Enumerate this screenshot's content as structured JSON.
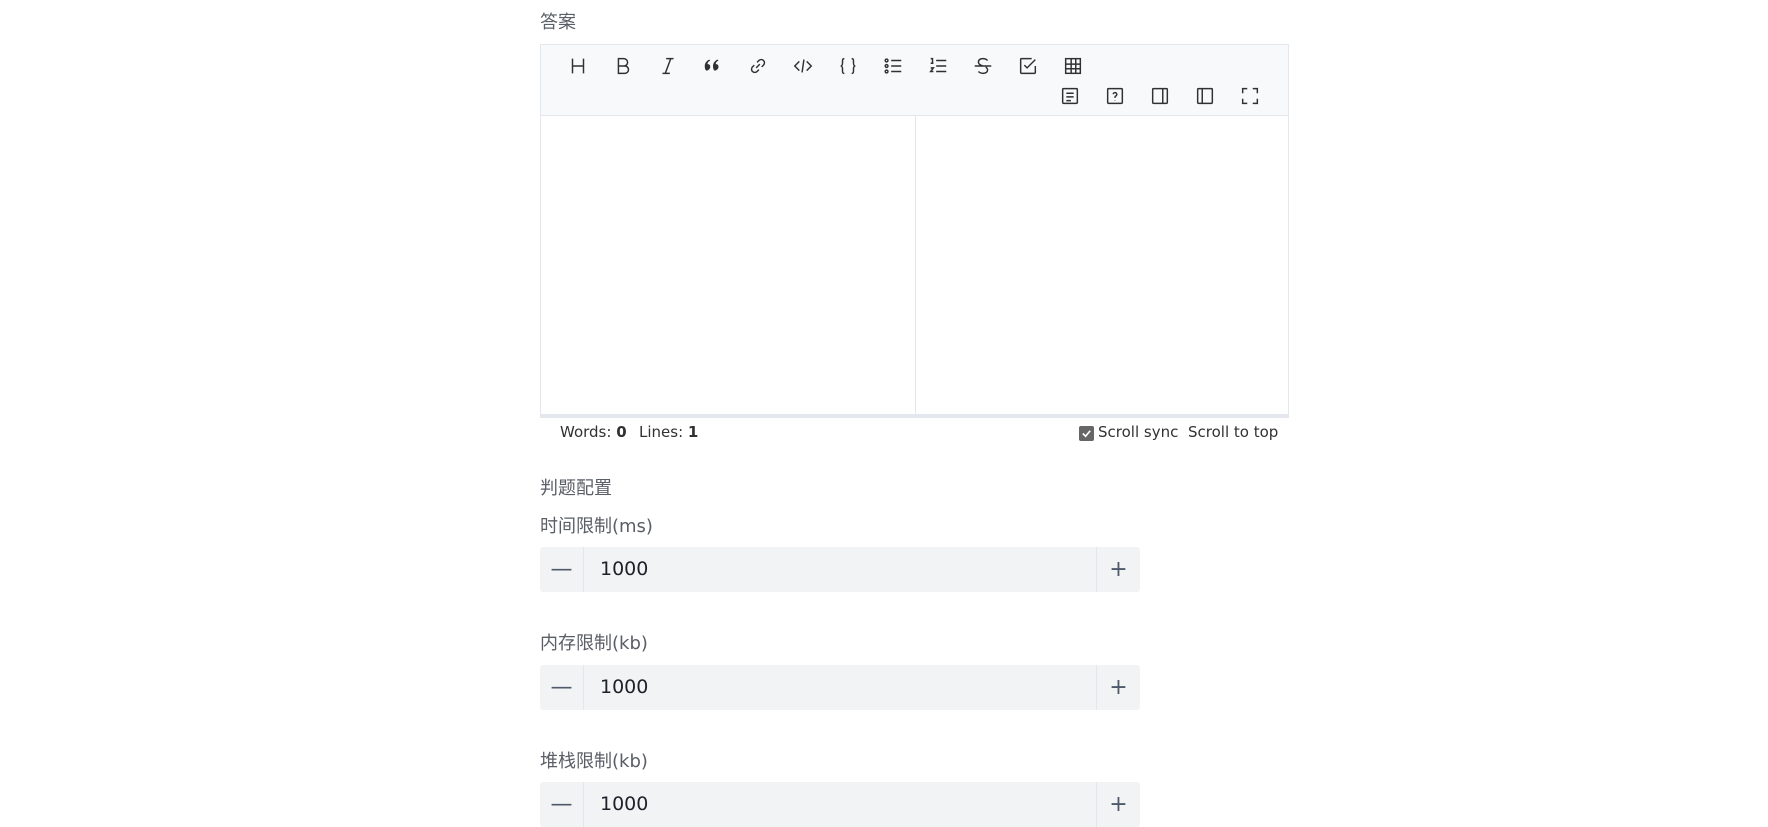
{
  "answer_section": {
    "label": "答案"
  },
  "toolbar": {
    "row1": [
      "heading",
      "bold",
      "italic",
      "quote",
      "link",
      "inline-code",
      "code-block",
      "unordered-list",
      "ordered-list",
      "strikethrough",
      "task-list",
      "table"
    ],
    "row2": [
      "syntax-help",
      "help",
      "preview-only",
      "side-by-side",
      "fullscreen"
    ]
  },
  "statusbar": {
    "words_label": "Words:",
    "words_value": "0",
    "lines_label": "Lines:",
    "lines_value": "1",
    "scroll_sync_label": "Scroll sync",
    "scroll_sync_checked": true,
    "scroll_top_label": "Scroll to top"
  },
  "judge_config": {
    "title": "判题配置",
    "time_limit": {
      "label": "时间限制(ms)",
      "value": "1000"
    },
    "memory_limit": {
      "label": "内存限制(kb)",
      "value": "1000"
    },
    "stack_limit": {
      "label": "堆栈限制(kb)",
      "value": "1000"
    }
  },
  "colors": {
    "label": "#5a5e66",
    "input_bg": "#f2f3f5",
    "toolbar_bg": "#f8f9fb",
    "border": "#e4e7ed"
  }
}
